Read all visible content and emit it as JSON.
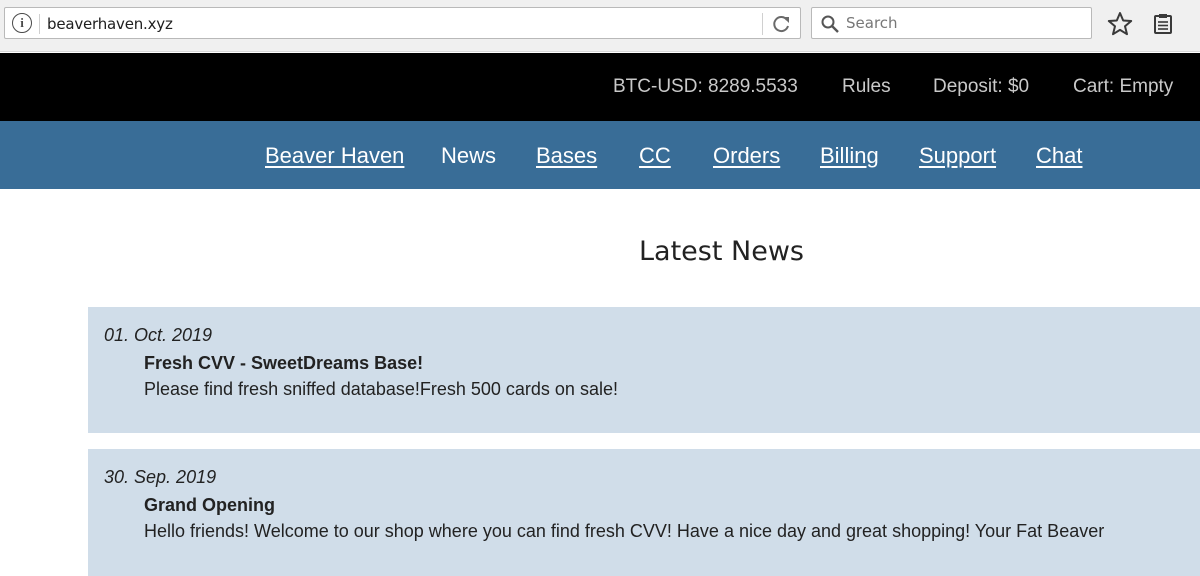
{
  "browser": {
    "url": "beaverhaven.xyz",
    "search_placeholder": "Search",
    "info_glyph": "i",
    "icons": [
      "info-icon",
      "reload-icon",
      "search-icon",
      "bookmark-star-icon",
      "reader-view-icon"
    ]
  },
  "top_bar": {
    "btc_rate": "BTC-USD: 8289.5533",
    "rules": "Rules",
    "deposit": "Deposit: $0",
    "cart": "Cart:  Empty"
  },
  "nav": {
    "items": [
      {
        "label": "Beaver Haven",
        "active": false
      },
      {
        "label": "News",
        "active": true
      },
      {
        "label": "Bases",
        "active": false
      },
      {
        "label": "CC",
        "active": false
      },
      {
        "label": "Orders",
        "active": false
      },
      {
        "label": "Billing",
        "active": false
      },
      {
        "label": "Support",
        "active": false
      },
      {
        "label": "Chat",
        "active": false
      }
    ]
  },
  "main": {
    "title": "Latest News",
    "news": [
      {
        "date": "01. Oct. 2019",
        "headline": "Fresh CVV - SweetDreams Base!",
        "body": "Please find fresh sniffed database!Fresh 500 cards on sale!"
      },
      {
        "date": "30. Sep. 2019",
        "headline": "Grand Opening",
        "body": "Hello friends! Welcome to our shop where you can find fresh CVV! Have a nice day and great shopping! Your Fat Beaver"
      }
    ]
  },
  "colors": {
    "top_bar_bg": "#000000",
    "nav_bg": "#396d97",
    "news_bg": "#d0dde9"
  }
}
